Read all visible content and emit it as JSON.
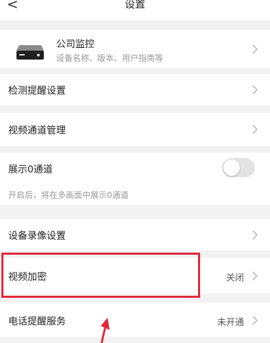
{
  "header": {
    "back_glyph": "<",
    "title": "设置",
    "back_icon": "chevron-left-icon"
  },
  "device": {
    "name": "公司监控",
    "subtitle": "设备名称、版本、用户指南等",
    "icon": "nvr-device-icon"
  },
  "items": [
    {
      "label": "检测提醒设置"
    },
    {
      "label": "视频通道管理"
    },
    {
      "label": "展示0通道",
      "toggle_on": false
    },
    {
      "label": "设备录像设置"
    },
    {
      "label": "视频加密",
      "value": "关闭"
    },
    {
      "label": "电话提醒服务",
      "value": "未开通"
    }
  ],
  "hint": "开启后，将在多画面中展示0通道",
  "colors": {
    "background": "#f2f2f2",
    "row": "#ffffff",
    "annotation": "#e0283a",
    "toggle_off": "#e3e3e3"
  },
  "annotation_icon": "pointer-arrow-icon"
}
